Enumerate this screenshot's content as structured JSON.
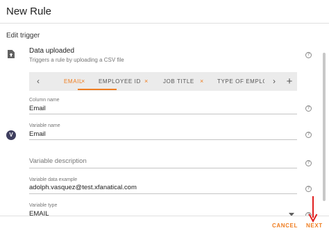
{
  "dialog": {
    "title": "New Rule"
  },
  "trigger": {
    "section_label": "Edit trigger",
    "icon": "file-upload-icon",
    "name": "Data uploaded",
    "description": "Triggers a rule by uploading a CSV file"
  },
  "tabs": {
    "items": [
      {
        "label": "EMAIL",
        "active": true
      },
      {
        "label": "EMPLOYEE ID",
        "active": false
      },
      {
        "label": "JOB TITLE",
        "active": false
      },
      {
        "label": "TYPE OF EMPLOY",
        "active": false
      }
    ],
    "close_glyph": "×",
    "add_glyph": "+"
  },
  "fields": {
    "column_name": {
      "label": "Column name",
      "value": "Email"
    },
    "variable_name": {
      "label": "Variable name",
      "value": "Email"
    },
    "variable_description": {
      "placeholder": "Variable description",
      "value": ""
    },
    "variable_example": {
      "label": "Variable data example",
      "value": "adolph.vasquez@test.xfanatical.com"
    },
    "variable_type": {
      "label": "Variable type",
      "value": "EMAIL"
    }
  },
  "variable_icon": {
    "letter": "V",
    "icon": "variable-icon"
  },
  "footer": {
    "cancel_label": "CANCEL",
    "next_label": "NEXT"
  },
  "colors": {
    "accent": "#ef7d20",
    "annotation_arrow": "#e02020"
  }
}
